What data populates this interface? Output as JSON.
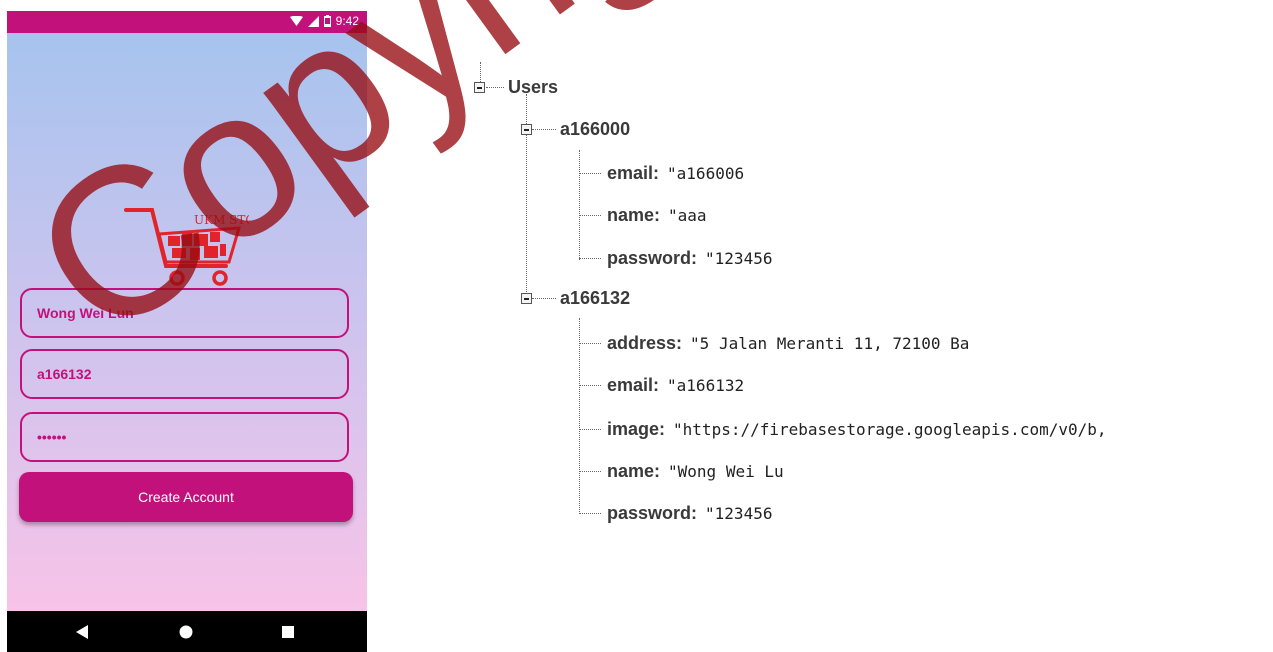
{
  "status_bar": {
    "time": "9:42"
  },
  "app": {
    "logo_text": "UKM STORE",
    "fields": {
      "name_value": "Wong Wei Lun",
      "id_value": "a166132",
      "password_value": "••••••"
    },
    "create_button_label": "Create Account"
  },
  "tree": {
    "root": "Users",
    "users": [
      {
        "id": "a166000",
        "fields": [
          {
            "key": "email:",
            "value": "\"a166006"
          },
          {
            "key": "name:",
            "value": "\"aaa"
          },
          {
            "key": "password:",
            "value": "\"123456"
          }
        ]
      },
      {
        "id": "a166132",
        "fields": [
          {
            "key": "address:",
            "value": "\"5 Jalan Meranti 11, 72100 Ba"
          },
          {
            "key": "email:",
            "value": "\"a166132"
          },
          {
            "key": "image:",
            "value": "\"https://firebasestorage.googleapis.com/v0/b,"
          },
          {
            "key": "name:",
            "value": "\"Wong Wei Lu"
          },
          {
            "key": "password:",
            "value": "\"123456"
          }
        ]
      }
    ]
  },
  "watermark": "Copyright",
  "colors": {
    "accent": "#c2117a",
    "watermark": "#960c12"
  }
}
